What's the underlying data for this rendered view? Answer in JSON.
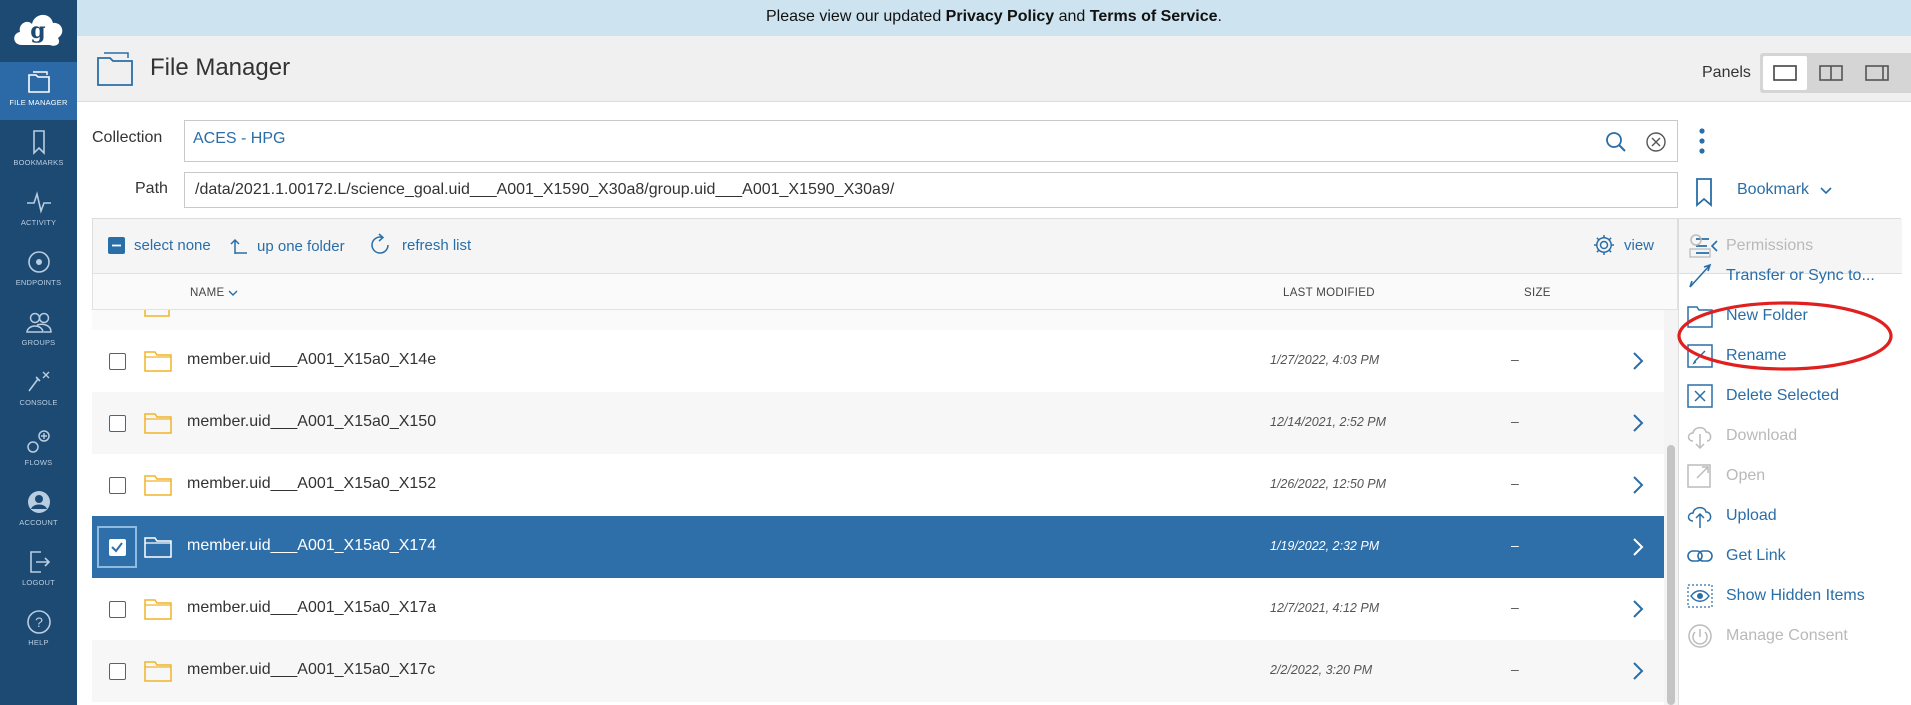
{
  "banner": {
    "prefix": "Please view our updated ",
    "privacy": "Privacy Policy",
    "and": " and ",
    "terms": "Terms of Service",
    "suffix": "."
  },
  "nav": [
    {
      "label": "FILE MANAGER",
      "icon": "file-manager-icon",
      "active": true
    },
    {
      "label": "BOOKMARKS",
      "icon": "bookmark-icon"
    },
    {
      "label": "ACTIVITY",
      "icon": "activity-icon"
    },
    {
      "label": "ENDPOINTS",
      "icon": "endpoints-icon"
    },
    {
      "label": "GROUPS",
      "icon": "groups-icon"
    },
    {
      "label": "CONSOLE",
      "icon": "console-icon"
    },
    {
      "label": "FLOWS",
      "icon": "flows-icon"
    },
    {
      "label": "ACCOUNT",
      "icon": "account-icon"
    },
    {
      "label": "LOGOUT",
      "icon": "logout-icon"
    },
    {
      "label": "HELP",
      "icon": "help-icon"
    }
  ],
  "header": {
    "title": "File Manager",
    "panels_label": "Panels"
  },
  "collection": {
    "label": "Collection",
    "value": "ACES - HPG"
  },
  "path": {
    "label": "Path",
    "value": "/data/2021.1.00172.L/science_goal.uid___A001_X1590_X30a8/group.uid___A001_X1590_X30a9/"
  },
  "bookmark": {
    "label": "Bookmark"
  },
  "toolbar": {
    "select_none": "select none",
    "up_one_folder": "up one folder",
    "refresh_list": "refresh list",
    "view": "view"
  },
  "table": {
    "columns": {
      "name": "NAME",
      "modified": "LAST MODIFIED",
      "size": "SIZE"
    },
    "rows": [
      {
        "name": "member.uid___A001_X15a0_X14e",
        "modified": "1/27/2022, 4:03 PM",
        "size": "–",
        "selected": false
      },
      {
        "name": "member.uid___A001_X15a0_X150",
        "modified": "12/14/2021, 2:52 PM",
        "size": "–",
        "selected": false
      },
      {
        "name": "member.uid___A001_X15a0_X152",
        "modified": "1/26/2022, 12:50 PM",
        "size": "–",
        "selected": false
      },
      {
        "name": "member.uid___A001_X15a0_X174",
        "modified": "1/19/2022, 2:32 PM",
        "size": "–",
        "selected": true
      },
      {
        "name": "member.uid___A001_X15a0_X17a",
        "modified": "12/7/2021, 4:12 PM",
        "size": "–",
        "selected": false
      },
      {
        "name": "member.uid___A001_X15a0_X17c",
        "modified": "2/2/2022, 3:20 PM",
        "size": "–",
        "selected": false
      }
    ]
  },
  "actions": [
    {
      "label": "Permissions",
      "enabled": false
    },
    {
      "label": "Transfer or Sync to...",
      "enabled": true
    },
    {
      "label": "New Folder",
      "enabled": true
    },
    {
      "label": "Rename",
      "enabled": true
    },
    {
      "label": "Delete Selected",
      "enabled": true
    },
    {
      "label": "Download",
      "enabled": false
    },
    {
      "label": "Open",
      "enabled": false
    },
    {
      "label": "Upload",
      "enabled": true
    },
    {
      "label": "Get Link",
      "enabled": true
    },
    {
      "label": "Show Hidden Items",
      "enabled": true
    },
    {
      "label": "Manage Consent",
      "enabled": false
    }
  ],
  "colors": {
    "nav_bg": "#1d4a73",
    "nav_active": "#2b6aa6",
    "banner_bg": "#cde3ef",
    "link": "#2a6ea8",
    "selected_row": "#2e6fa9",
    "folder": "#f0b429",
    "annotation_circle": "#e0201f"
  }
}
